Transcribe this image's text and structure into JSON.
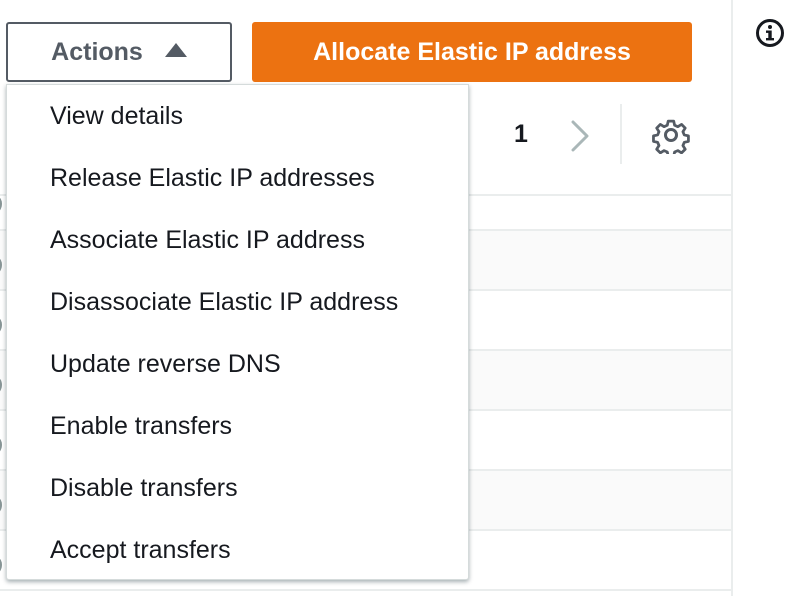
{
  "toolbar": {
    "actions_label": "Actions",
    "allocate_label": "Allocate Elastic IP address",
    "accent_color": "#ec7211"
  },
  "actions_menu": {
    "items": [
      {
        "label": "View details"
      },
      {
        "label": "Release Elastic IP addresses"
      },
      {
        "label": "Associate Elastic IP address"
      },
      {
        "label": "Disassociate Elastic IP address"
      },
      {
        "label": "Update reverse DNS"
      },
      {
        "label": "Enable transfers"
      },
      {
        "label": "Disable transfers"
      },
      {
        "label": "Accept transfers"
      }
    ]
  },
  "pagination": {
    "current_page": "1"
  },
  "icons": {
    "info": "info-icon",
    "caret": "caret-up-icon",
    "next": "chevron-right-icon",
    "settings": "gear-icon"
  }
}
